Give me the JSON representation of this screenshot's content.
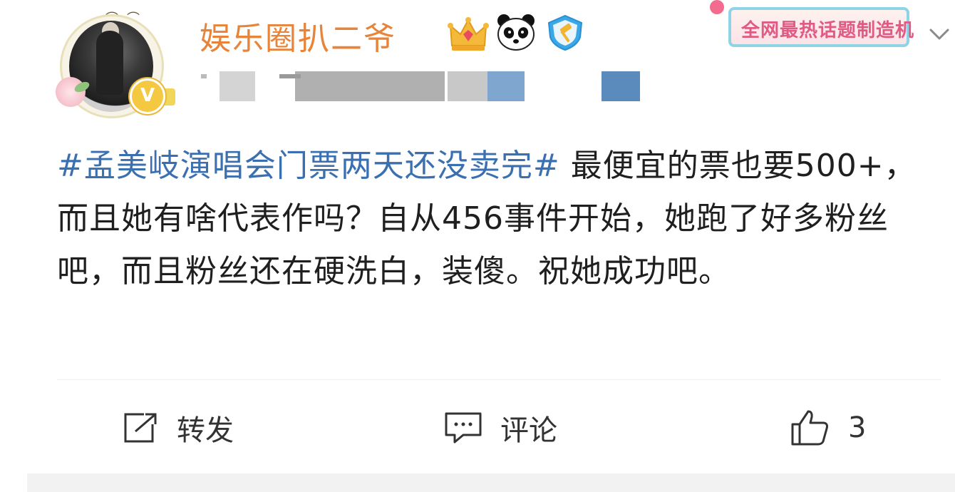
{
  "post": {
    "username": "娱乐圈扒二爷",
    "badges": [
      "crown-icon",
      "panda-icon",
      "shield-hammer-icon"
    ],
    "tag_card": "全网最热话题制造机",
    "content": {
      "topic": "#孟美岐演唱会门票两天还没卖完#",
      "text": " 最便宜的票也要500+，而且她有啥代表作吗？自从456事件开始，她跑了好多粉丝吧，而且粉丝还在硬洗白，装傻。祝她成功吧。"
    },
    "actions": {
      "repost_label": "转发",
      "comment_label": "评论",
      "like_count": "3"
    }
  },
  "colors": {
    "username": "#e8843a",
    "topic": "#3a6fb0",
    "text": "#1f1f1f",
    "tag_text": "#e05a86"
  }
}
